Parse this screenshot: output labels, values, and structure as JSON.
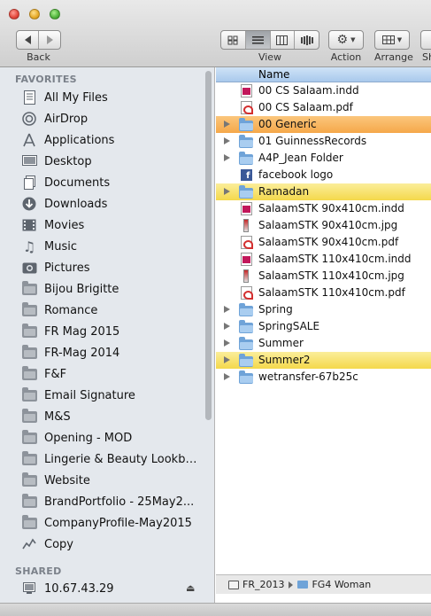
{
  "toolbar": {
    "back_label": "Back",
    "view_label": "View",
    "action_label": "Action",
    "arrange_label": "Arrange",
    "share_label": "Sh"
  },
  "sidebar": {
    "favorites_header": "FAVORITES",
    "shared_header": "SHARED",
    "favorites": [
      {
        "label": "All My Files",
        "icon": "all-files-icon"
      },
      {
        "label": "AirDrop",
        "icon": "airdrop-icon"
      },
      {
        "label": "Applications",
        "icon": "applications-icon"
      },
      {
        "label": "Desktop",
        "icon": "desktop-icon"
      },
      {
        "label": "Documents",
        "icon": "documents-icon"
      },
      {
        "label": "Downloads",
        "icon": "downloads-icon"
      },
      {
        "label": "Movies",
        "icon": "movies-icon"
      },
      {
        "label": "Music",
        "icon": "music-icon"
      },
      {
        "label": "Pictures",
        "icon": "pictures-icon"
      },
      {
        "label": "Bijou Brigitte",
        "icon": "folder-icon"
      },
      {
        "label": "Romance",
        "icon": "folder-icon"
      },
      {
        "label": "FR Mag 2015",
        "icon": "folder-icon"
      },
      {
        "label": "FR-Mag 2014",
        "icon": "folder-icon"
      },
      {
        "label": "F&F",
        "icon": "folder-icon"
      },
      {
        "label": "Email Signature",
        "icon": "folder-icon"
      },
      {
        "label": "M&S",
        "icon": "folder-icon"
      },
      {
        "label": "Opening - MOD",
        "icon": "folder-icon"
      },
      {
        "label": "Lingerie & Beauty Lookbook",
        "icon": "folder-icon"
      },
      {
        "label": "Website",
        "icon": "folder-icon"
      },
      {
        "label": "BrandPortfolio - 25May2...",
        "icon": "folder-icon"
      },
      {
        "label": "CompanyProfile-May2015",
        "icon": "folder-icon"
      },
      {
        "label": "Copy",
        "icon": "copy-icon"
      }
    ],
    "shared": [
      {
        "label": "10.67.43.29",
        "icon": "server-icon"
      }
    ]
  },
  "filelist": {
    "column_name": "Name",
    "rows": [
      {
        "name": "00 CS Salaam.indd",
        "type": "indd",
        "folder": false,
        "label": "none"
      },
      {
        "name": "00 CS Salaam.pdf",
        "type": "pdf",
        "folder": false,
        "label": "none"
      },
      {
        "name": "00 Generic",
        "type": "folder",
        "folder": true,
        "label": "orange"
      },
      {
        "name": "01 GuinnessRecords",
        "type": "folder",
        "folder": true,
        "label": "none"
      },
      {
        "name": "A4P_Jean Folder",
        "type": "folder",
        "folder": true,
        "label": "none"
      },
      {
        "name": "facebook logo",
        "type": "fb",
        "folder": false,
        "label": "none"
      },
      {
        "name": "Ramadan",
        "type": "folder",
        "folder": true,
        "label": "yellow"
      },
      {
        "name": "SalaamSTK 90x410cm.indd",
        "type": "indd",
        "folder": false,
        "label": "none"
      },
      {
        "name": "SalaamSTK 90x410cm.jpg",
        "type": "jpg",
        "folder": false,
        "label": "none"
      },
      {
        "name": "SalaamSTK 90x410cm.pdf",
        "type": "pdf",
        "folder": false,
        "label": "none"
      },
      {
        "name": "SalaamSTK 110x410cm.indd",
        "type": "indd",
        "folder": false,
        "label": "none"
      },
      {
        "name": "SalaamSTK 110x410cm.jpg",
        "type": "jpg",
        "folder": false,
        "label": "none"
      },
      {
        "name": "SalaamSTK 110x410cm.pdf",
        "type": "pdf",
        "folder": false,
        "label": "none"
      },
      {
        "name": "Spring",
        "type": "folder",
        "folder": true,
        "label": "none"
      },
      {
        "name": "SpringSALE",
        "type": "folder",
        "folder": true,
        "label": "none"
      },
      {
        "name": "Summer",
        "type": "folder",
        "folder": true,
        "label": "none"
      },
      {
        "name": "Summer2",
        "type": "folder",
        "folder": true,
        "label": "yellow"
      },
      {
        "name": "wetransfer-67b25c",
        "type": "folder",
        "folder": true,
        "label": "none"
      }
    ]
  },
  "pathbar": {
    "items": [
      "FR_2013",
      "FG4 Woman"
    ]
  },
  "colors": {
    "label_orange": "#f5a84a",
    "label_yellow": "#f4d84c",
    "header_blue": "#a9c9ec",
    "sidebar_bg": "#e4e8ed"
  }
}
